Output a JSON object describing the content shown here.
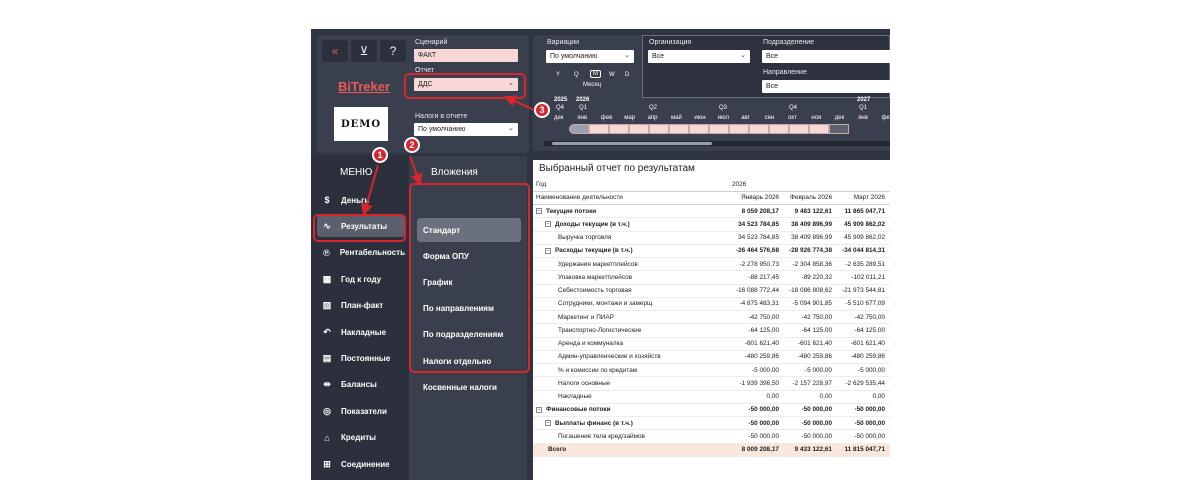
{
  "top_icons": [
    {
      "icon": "double-chevron-left-icon",
      "glyph": "«"
    },
    {
      "icon": "filter-clear-icon",
      "glyph": "⊻"
    },
    {
      "icon": "help-icon",
      "glyph": "?"
    }
  ],
  "brand": "BiTreker",
  "logo_text": "DEMO",
  "filters": {
    "scenario_label": "Сценарий",
    "scenario_value": "ФАКТ",
    "report_label": "Отчет",
    "report_value": "ДДС",
    "taxes_label": "Налоги в отчете",
    "taxes_value": "По умолчанию"
  },
  "variations": {
    "label": "Вариации",
    "value": "По умолчанию",
    "periods": [
      "Y",
      "Q",
      "M",
      "W",
      "D"
    ],
    "period_caption": "Месяц",
    "organization_label": "Организация",
    "organization_value": "Все",
    "division_label": "Подразделение",
    "division_value": "Все",
    "direction_label": "Направление",
    "direction_value": "Все"
  },
  "timeline": {
    "years": [
      "2025",
      "2026",
      "2027"
    ],
    "quarters": [
      "Q4",
      "Q1",
      "Q2",
      "Q3",
      "Q4",
      "Q1"
    ],
    "months": [
      "дек",
      "янв",
      "фев",
      "мар",
      "апр",
      "май",
      "июн",
      "июл",
      "авг",
      "сен",
      "окт",
      "ноя",
      "дек",
      "янв",
      "фев"
    ]
  },
  "menu": {
    "title": "МЕНЮ",
    "items": [
      {
        "label": "Деньги",
        "icon": "dollar-icon",
        "glyph": "$"
      },
      {
        "label": "Результаты",
        "icon": "line-chart-icon",
        "glyph": "∿"
      },
      {
        "label": "Рентабельность",
        "icon": "percent-icon",
        "glyph": "℗"
      },
      {
        "label": "Год к году",
        "icon": "calendar-icon",
        "glyph": "▦"
      },
      {
        "label": "План-факт",
        "icon": "image-icon",
        "glyph": "▨"
      },
      {
        "label": "Накладные",
        "icon": "undo-icon",
        "glyph": "↶"
      },
      {
        "label": "Постоянные",
        "icon": "bar-chart-icon",
        "glyph": "▤"
      },
      {
        "label": "Балансы",
        "icon": "balance-icon",
        "glyph": "⇹"
      },
      {
        "label": "Показатели",
        "icon": "gauge-icon",
        "glyph": "◎"
      },
      {
        "label": "Кредиты",
        "icon": "bank-icon",
        "glyph": "⌂"
      },
      {
        "label": "Соединение",
        "icon": "connection-icon",
        "glyph": "⊞"
      }
    ]
  },
  "submenu": {
    "title": "Вложения",
    "items": [
      "Стандарт",
      "Форма ОПУ",
      "График",
      "По направлениям",
      "По подразделениям",
      "Налоги отдельно",
      "Косвенные налоги"
    ]
  },
  "report": {
    "title": "Выбранный отчет по результатам",
    "year_label": "Год",
    "year_value": "2026",
    "name_header": "Наименование деятельности",
    "month_headers": [
      "Январь 2026",
      "Февраль 2026",
      "Март 2026"
    ],
    "rows": [
      {
        "level": 1,
        "expander": "⊟",
        "name": "Текущие потоки",
        "v": [
          "8 059 208,17",
          "9 483 122,61",
          "11 865 047,71"
        ]
      },
      {
        "level": 2,
        "expander": "⊟",
        "name": "Доходы текущие (в т.ч.)",
        "v": [
          "34 523 784,85",
          "38 409 896,99",
          "45 909 862,02"
        ]
      },
      {
        "level": 3,
        "expander": "",
        "name": "Выручка торговля",
        "v": [
          "34 523 784,85",
          "38 409 896,99",
          "45 909 862,02"
        ]
      },
      {
        "level": 2,
        "expander": "⊟",
        "name": "Расходы текущие (в т.ч.)",
        "v": [
          "-26 464 576,68",
          "-28 926 774,38",
          "-34 044 814,31"
        ]
      },
      {
        "level": 3,
        "expander": "",
        "name": "Удержания маркетплейсов",
        "v": [
          "-2 278 950,73",
          "-2 304 858,36",
          "-2 635 289,51"
        ]
      },
      {
        "level": 3,
        "expander": "",
        "name": "Упаковка маркетплейсов",
        "v": [
          "-88 217,45",
          "-89 220,32",
          "-102 011,21"
        ]
      },
      {
        "level": 3,
        "expander": "",
        "name": "Себестоимость торговая",
        "v": [
          "-16 088 772,44",
          "-18 086 808,62",
          "-21 973 544,81"
        ]
      },
      {
        "level": 3,
        "expander": "",
        "name": "Сотрудники, монтажи и замерщ",
        "v": [
          "-4 875 483,31",
          "-5 094 901,85",
          "-5 510 677,09"
        ]
      },
      {
        "level": 3,
        "expander": "",
        "name": "Маркетинг и ПИАР",
        "v": [
          "-42 750,00",
          "-42 750,00",
          "-42 750,00"
        ]
      },
      {
        "level": 3,
        "expander": "",
        "name": "Транспортно-Логистические",
        "v": [
          "-64 125,00",
          "-64 125,00",
          "-64 125,00"
        ]
      },
      {
        "level": 3,
        "expander": "",
        "name": "Аренда и коммуналка",
        "v": [
          "-601 621,40",
          "-601 621,40",
          "-601 621,40"
        ]
      },
      {
        "level": 3,
        "expander": "",
        "name": "Админ-управленческие и хозяйств",
        "v": [
          "-480 259,86",
          "-480 259,86",
          "-480 259,86"
        ]
      },
      {
        "level": 3,
        "expander": "",
        "name": "% и комиссии по кредитам",
        "v": [
          "-5 000,00",
          "-5 000,00",
          "-5 000,00"
        ]
      },
      {
        "level": 3,
        "expander": "",
        "name": "Налоги основные",
        "v": [
          "-1 939 396,50",
          "-2 157 228,97",
          "-2 629 535,44"
        ]
      },
      {
        "level": 3,
        "expander": "",
        "name": "Накладные",
        "v": [
          "0,00",
          "0,00",
          "0,00"
        ]
      },
      {
        "level": 1,
        "expander": "⊟",
        "name": "Финансовые потоки",
        "v": [
          "-50 000,00",
          "-50 000,00",
          "-50 000,00"
        ]
      },
      {
        "level": 2,
        "expander": "⊟",
        "name": "Выплаты финанс (в т.ч.)",
        "v": [
          "-50 000,00",
          "-50 000,00",
          "-50 000,00"
        ]
      },
      {
        "level": 3,
        "expander": "",
        "name": "Погашение тела кред/займов",
        "v": [
          "-50 000,00",
          "-50 000,00",
          "-50 000,00"
        ]
      },
      {
        "level": 0,
        "expander": "",
        "name": "Всего",
        "v": [
          "8 009 208,17",
          "9 433 122,61",
          "11 815 047,71"
        ]
      }
    ]
  },
  "annotations": [
    "1",
    "2",
    "3"
  ],
  "colors": {
    "highlight": "#d8262f",
    "panel": "#3a3f4d",
    "field": "#f8d7d7"
  }
}
